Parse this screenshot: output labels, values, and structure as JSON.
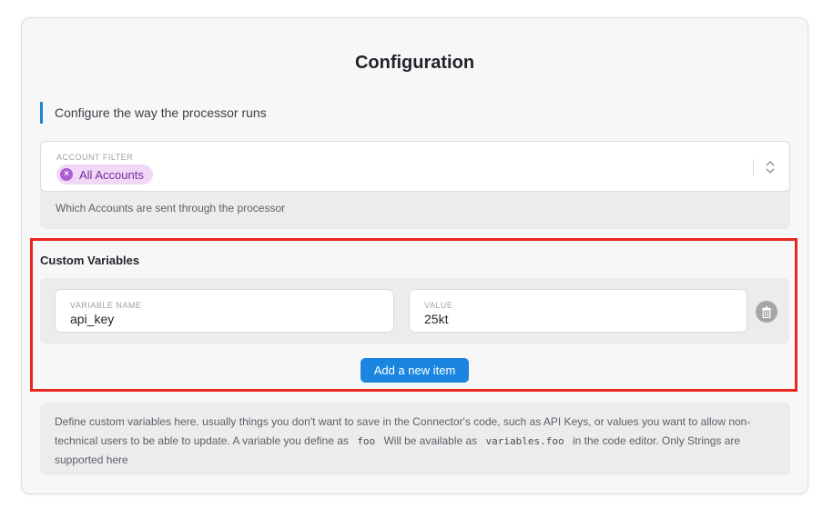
{
  "config": {
    "title": "Configuration",
    "intro": "Configure the way the processor runs"
  },
  "account_filter": {
    "label": "ACCOUNT FILTER",
    "selected_chip": "All Accounts",
    "help": "Which Accounts are sent through the processor"
  },
  "custom_variables": {
    "title": "Custom Variables",
    "items": [
      {
        "name_label": "VARIABLE NAME",
        "name": "api_key",
        "value_label": "VALUE",
        "value": "25kt"
      }
    ],
    "add_button": "Add a new item",
    "help_1": "Define custom variables here. usually things you don't want to save in the Connector's code, such as API Keys, or values you want to allow non-technical users to be able to update. A variable you define as",
    "help_code_1": "foo",
    "help_2": "Will be available as",
    "help_code_2": "variables.foo",
    "help_3": "in the code editor. Only Strings are supported here"
  },
  "colors": {
    "accent": "#1a86e0",
    "chip_bg": "#f0d8f6",
    "chip_text": "#7a2d9a",
    "highlight_border": "#e8261f"
  },
  "icons": {
    "chip_remove": "close-circle-icon",
    "select_toggle": "chevron-up-down-icon",
    "delete_row": "trash-icon"
  }
}
